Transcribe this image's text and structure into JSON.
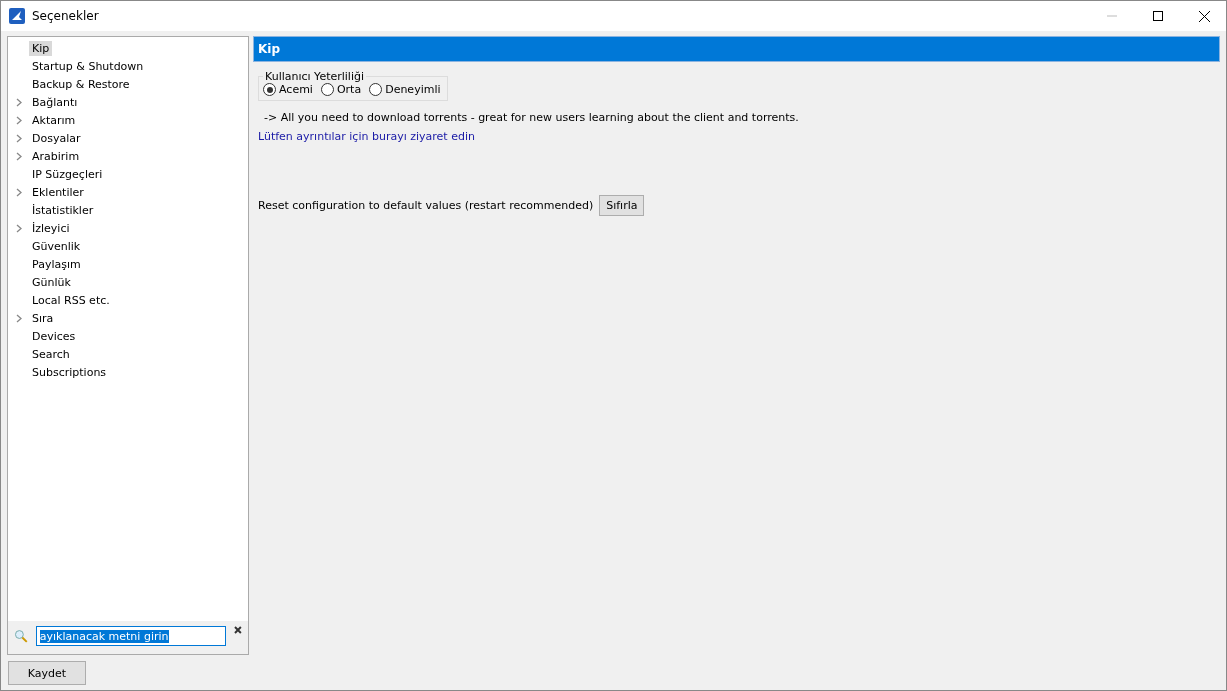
{
  "window": {
    "title": "Seçenekler"
  },
  "sidebar": {
    "items": [
      {
        "label": "Kip",
        "expandable": false,
        "selected": true
      },
      {
        "label": "Startup & Shutdown",
        "expandable": false,
        "selected": false
      },
      {
        "label": "Backup & Restore",
        "expandable": false,
        "selected": false
      },
      {
        "label": "Bağlantı",
        "expandable": true,
        "selected": false
      },
      {
        "label": "Aktarım",
        "expandable": true,
        "selected": false
      },
      {
        "label": "Dosyalar",
        "expandable": true,
        "selected": false
      },
      {
        "label": "Arabirim",
        "expandable": true,
        "selected": false
      },
      {
        "label": "IP Süzgeçleri",
        "expandable": false,
        "selected": false
      },
      {
        "label": "Eklentiler",
        "expandable": true,
        "selected": false
      },
      {
        "label": "İstatistikler",
        "expandable": false,
        "selected": false
      },
      {
        "label": "İzleyici",
        "expandable": true,
        "selected": false
      },
      {
        "label": "Güvenlik",
        "expandable": false,
        "selected": false
      },
      {
        "label": "Paylaşım",
        "expandable": false,
        "selected": false
      },
      {
        "label": "Günlük",
        "expandable": false,
        "selected": false
      },
      {
        "label": "Local RSS etc.",
        "expandable": false,
        "selected": false
      },
      {
        "label": "Sıra",
        "expandable": true,
        "selected": false
      },
      {
        "label": "Devices",
        "expandable": false,
        "selected": false
      },
      {
        "label": "Search",
        "expandable": false,
        "selected": false
      },
      {
        "label": "Subscriptions",
        "expandable": false,
        "selected": false
      }
    ],
    "filter": {
      "value": "ayıklanacak metni girin",
      "text_selected": true
    }
  },
  "panel": {
    "title": "Kip",
    "group": {
      "title": "Kullanıcı Yeterliliği",
      "options": [
        {
          "label": "Acemi",
          "selected": true
        },
        {
          "label": "Orta",
          "selected": false
        },
        {
          "label": "Deneyimli",
          "selected": false
        }
      ]
    },
    "description": "-> All you need to download torrents - great for new users learning about the client and torrents.",
    "link": "Lütfen ayrıntılar için burayı ziyaret edin",
    "reset_label": "Reset configuration to default values (restart recommended)",
    "reset_button": "Sıfırla"
  },
  "buttons": [
    "Kaydet"
  ]
}
